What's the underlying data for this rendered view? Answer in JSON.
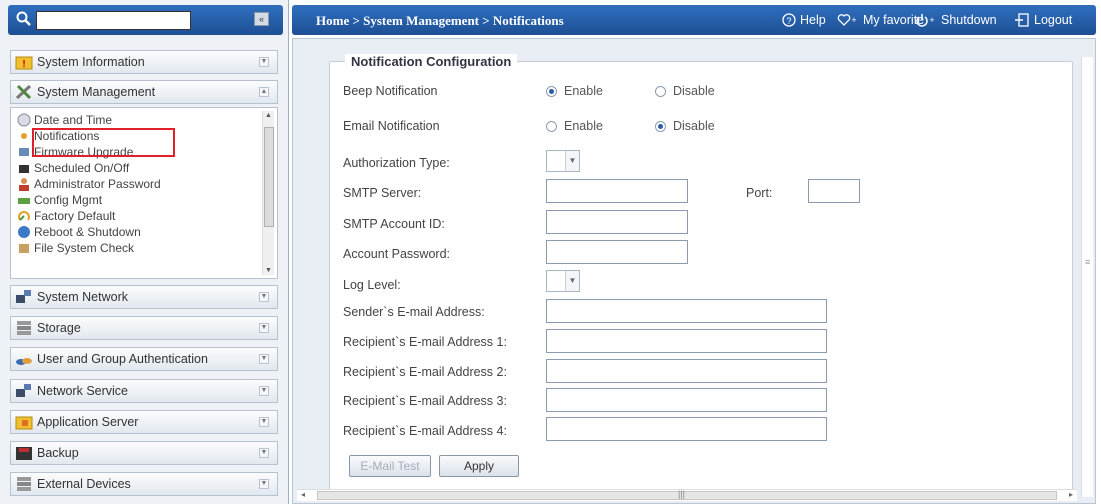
{
  "search": {
    "placeholder": "",
    "value": "",
    "collapse_label": "«"
  },
  "sidebar": {
    "categories": [
      {
        "label": "System Information",
        "icon": "info-folder-icon"
      },
      {
        "label": "System Management",
        "icon": "tools-icon"
      },
      {
        "label": "System Network",
        "icon": "network-icon"
      },
      {
        "label": "Storage",
        "icon": "storage-icon"
      },
      {
        "label": "User and Group Authentication",
        "icon": "users-icon"
      },
      {
        "label": "Network Service",
        "icon": "network-service-icon"
      },
      {
        "label": "Application Server",
        "icon": "app-folder-icon"
      },
      {
        "label": "Backup",
        "icon": "backup-icon"
      },
      {
        "label": "External Devices",
        "icon": "external-devices-icon"
      }
    ],
    "submenu": [
      {
        "label": "Date and Time"
      },
      {
        "label": "Notifications"
      },
      {
        "label": "Firmware Upgrade"
      },
      {
        "label": "Scheduled On/Off"
      },
      {
        "label": "Administrator Password"
      },
      {
        "label": "Config Mgmt"
      },
      {
        "label": "Factory Default"
      },
      {
        "label": "Reboot & Shutdown"
      },
      {
        "label": "File System Check"
      }
    ]
  },
  "header": {
    "breadcrumb": "Home > System Management > Notifications",
    "help": "Help",
    "favorite": "My favorite",
    "shutdown": "Shutdown",
    "logout": "Logout"
  },
  "form": {
    "legend": "Notification Configuration",
    "beep_label": "Beep Notification",
    "email_label": "Email Notification",
    "enable": "Enable",
    "disable": "Disable",
    "beep_selected": "Enable",
    "email_selected": "Disable",
    "auth_label": "Authorization Type:",
    "smtp_server_label": "SMTP Server:",
    "port_label": "Port:",
    "smtp_account_label": "SMTP Account ID:",
    "account_password_label": "Account Password:",
    "log_level_label": "Log Level:",
    "sender_label": "Sender`s E-mail Address:",
    "recipient1_label": "Recipient`s E-mail Address 1:",
    "recipient2_label": "Recipient`s E-mail Address 2:",
    "recipient3_label": "Recipient`s E-mail Address 3:",
    "recipient4_label": "Recipient`s E-mail Address 4:",
    "email_test_button": "E-Mail Test",
    "apply_button": "Apply"
  },
  "colors": {
    "header_blue": "#1d4f94",
    "highlight_red": "#e0202a"
  }
}
